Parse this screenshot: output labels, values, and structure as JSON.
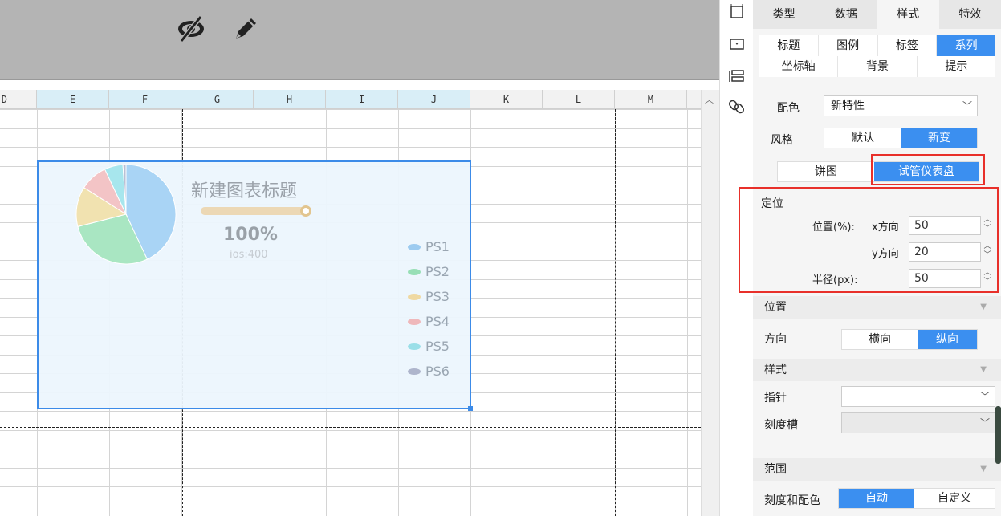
{
  "toolbar": {
    "icons": [
      "eye-slash-icon",
      "pencil-icon"
    ]
  },
  "sheet": {
    "columns": [
      "D",
      "E",
      "F",
      "G",
      "H",
      "I",
      "J",
      "K",
      "L",
      "M"
    ]
  },
  "chart": {
    "title": "新建图表标题",
    "gauge_value": "100%",
    "gauge_sub": "ios:400",
    "pie_slices": [
      {
        "name": "PS1",
        "value": 43,
        "color": "#a9d4f5"
      },
      {
        "name": "PS2",
        "value": 28,
        "color": "#a9e6c2"
      },
      {
        "name": "PS3",
        "value": 13,
        "color": "#f1e2b0"
      },
      {
        "name": "PS4",
        "value": 9,
        "color": "#f3c4c6"
      },
      {
        "name": "PS5",
        "value": 6,
        "color": "#a7e6ed"
      },
      {
        "name": "PS6",
        "value": 1,
        "color": "#b9bfd4"
      }
    ],
    "legend": [
      {
        "label": "PS1",
        "color": "#9ccbf0"
      },
      {
        "label": "PS2",
        "color": "#98dfb6"
      },
      {
        "label": "PS3",
        "color": "#efd9a2"
      },
      {
        "label": "PS4",
        "color": "#efb8bb"
      },
      {
        "label": "PS5",
        "color": "#9adfe8"
      },
      {
        "label": "PS6",
        "color": "#aeb5cc"
      }
    ]
  },
  "panel": {
    "main_tabs": [
      "类型",
      "数据",
      "样式",
      "特效"
    ],
    "sub_tabs_row1": [
      "标题",
      "图例",
      "标签",
      "系列"
    ],
    "sub_tabs_row2": [
      "坐标轴",
      "背景",
      "提示"
    ],
    "color_label": "配色",
    "color_value": "新特性",
    "style_label": "风格",
    "style_options": [
      "默认",
      "新变"
    ],
    "type_options": [
      "饼图",
      "试管仪表盘"
    ],
    "positioning": {
      "title": "定位",
      "position_label": "位置(%):",
      "x_label": "x方向",
      "x_value": "50",
      "y_label": "y方向",
      "y_value": "20",
      "radius_label": "半径(px):",
      "radius_value": "50"
    },
    "position_section": "位置",
    "direction_label": "方向",
    "direction_options": [
      "横向",
      "纵向"
    ],
    "style_section": "样式",
    "pointer_label": "指针",
    "pointer_value": "",
    "groove_label": "刻度槽",
    "groove_value": "",
    "range_section": "范围",
    "scale_color_label": "刻度和配色",
    "scale_options": [
      "自动",
      "自定义"
    ]
  },
  "colors": {
    "accent": "#3b8ff0",
    "highlight_box": "#e8302a",
    "chart_border": "#3c8be8"
  }
}
